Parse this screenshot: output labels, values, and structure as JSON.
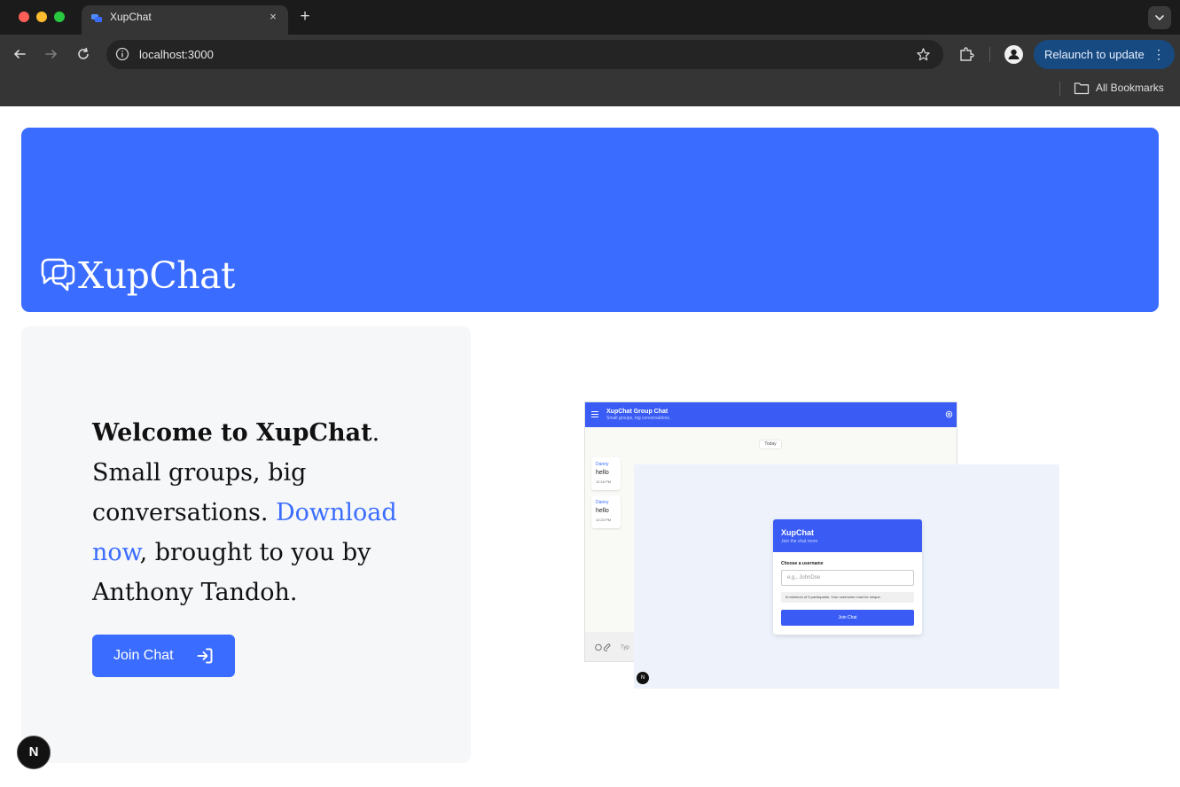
{
  "browser": {
    "tab": {
      "title": "XupChat",
      "favicon": "chat-bubbles-icon",
      "close": "×"
    },
    "new_tab": "+",
    "address": "localhost:3000",
    "relaunch_label": "Relaunch to update",
    "relaunch_menu": "⋮",
    "bookmarks_label": "All Bookmarks",
    "colors": {
      "tab_bg": "#353535",
      "relaunch_bg": "#174a80"
    }
  },
  "hero": {
    "brand": "XupChat",
    "logo": "chat-bubbles-icon",
    "color": "#3a6cff"
  },
  "welcome": {
    "headline": "Welcome to XupChat",
    "headline_end": ".",
    "body_before_link": " Small groups, big conversations. ",
    "link_text": "Download now",
    "body_after_link": ", brought to you by Anthony Tandoh.",
    "join_label": "Join Chat",
    "join_icon": "login-arrow-icon"
  },
  "preview": {
    "chat": {
      "title": "XupChat Group Chat",
      "subtitle": "Small groups, big conversations.",
      "date_chip": "Today",
      "messages": [
        {
          "sender": "Danny",
          "text": "hello",
          "time": "12:16 PM"
        },
        {
          "sender": "Danny",
          "text": "hello",
          "time": "12:23 PM"
        }
      ],
      "input_placeholder": "Typ"
    },
    "join": {
      "title": "XupChat",
      "subtitle": "Join the chat room",
      "field_label": "Choose a username",
      "placeholder": "e.g., JohnDoe",
      "note": "A minimum of 5 participants. Your username must be unique.",
      "button": "Join Chat",
      "badge": "N"
    }
  },
  "dev_badge": "N"
}
